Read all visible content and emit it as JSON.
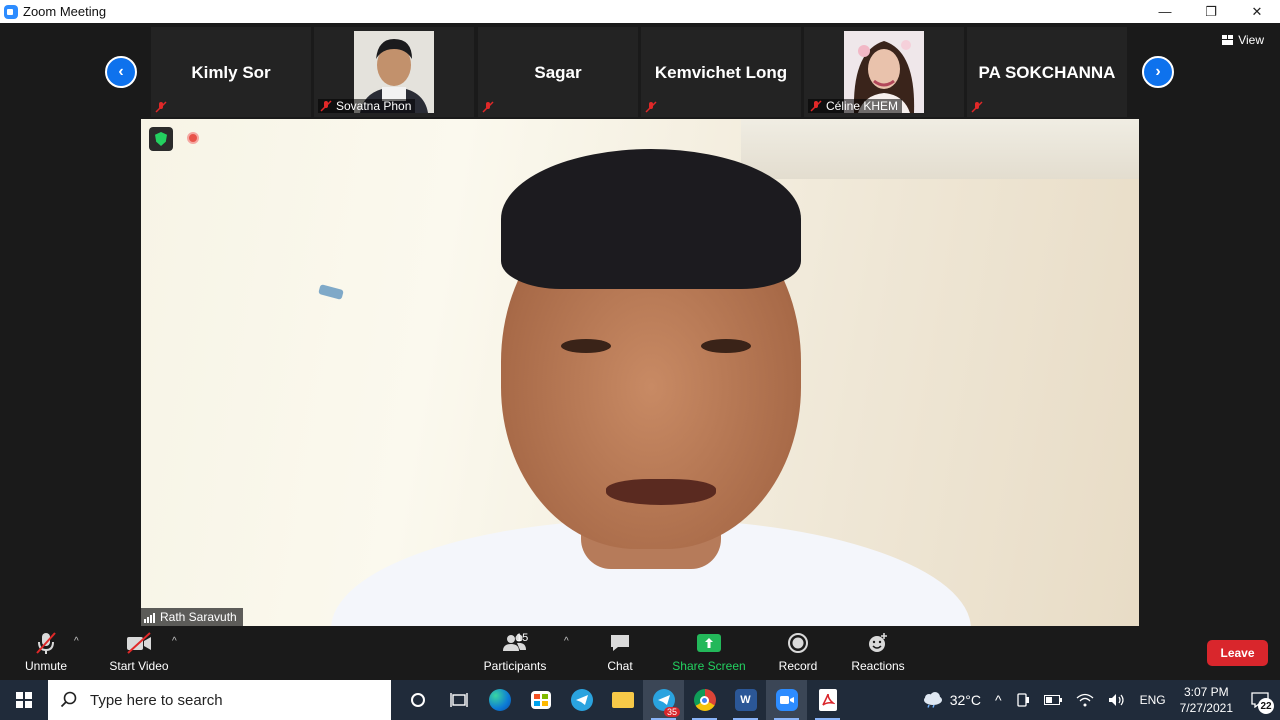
{
  "window": {
    "title": "Zoom Meeting",
    "controls": [
      "—",
      "❐",
      "✕"
    ]
  },
  "strip": {
    "prev_icon": "‹",
    "next_icon": "›",
    "view_label": "View",
    "participants": [
      {
        "name": "Kimly Sor",
        "has_video": false
      },
      {
        "name": "Sovatna Phon",
        "has_video": true
      },
      {
        "name": "Sagar",
        "has_video": false
      },
      {
        "name": "Kemvichet Long",
        "has_video": true,
        "name_only": true
      },
      {
        "name": "Céline KHEM",
        "has_video": true
      },
      {
        "name": "PA SOKCHANNA",
        "has_video": false
      }
    ]
  },
  "main": {
    "speaker_name": "Rath Saravuth"
  },
  "toolbar": {
    "unmute_label": "Unmute",
    "start_video_label": "Start Video",
    "participants_label": "Participants",
    "participants_count": "15",
    "chat_label": "Chat",
    "share_label": "Share Screen",
    "record_label": "Record",
    "reactions_label": "Reactions",
    "leave_label": "Leave",
    "caret": "^"
  },
  "taskbar": {
    "search_placeholder": "Type here to search",
    "telegram_badge": "35",
    "temperature": "32°C",
    "language": "ENG",
    "time": "3:07 PM",
    "date": "7/27/2021",
    "notification_count": "22",
    "tray_caret": "^",
    "word_letter": "W"
  },
  "colors": {
    "accent_blue": "#0e72ed",
    "leave_red": "#d9262c",
    "share_green": "#23d160"
  }
}
